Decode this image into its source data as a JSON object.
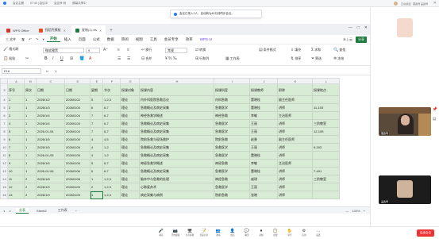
{
  "meeting": {
    "top_items": [
      "会议主题",
      "07:43 | 会议中",
      "会议号 码",
      "屏幕共享中"
    ],
    "right_label": "正在讲话：董鑫琦 盖鑫琦",
    "toast": "会议已录入2人，自动转为40分钟同步会议。"
  },
  "tabs": [
    {
      "label": "WPS Office",
      "color": "#d9342b",
      "active": false
    },
    {
      "label": "找稻壳模板",
      "color": "#e8491d",
      "active": false
    },
    {
      "label": "复制(1).xls",
      "color": "#1f7a3f",
      "active": true
    }
  ],
  "menu": {
    "file": "三 文件",
    "items": [
      "开始",
      "插入",
      "页面",
      "公式",
      "数据",
      "审阅",
      "视图",
      "工具",
      "会员专享",
      "效率"
    ],
    "active_index": 0,
    "wps_ai": "WPS AI",
    "right": [
      "未上云",
      "分享"
    ]
  },
  "ribbon": {
    "format_painter": "格式刷",
    "paste": "粘贴",
    "font_name": "微软雅黑",
    "font_size": "9",
    "wrap": "换行",
    "merge": "合并",
    "number_format": "常规",
    "convert": "转换",
    "rows_cols": "行和列",
    "worksheet": "工作表",
    "cond_format": "条件格式",
    "fill": "填充",
    "sort": "排序",
    "filter": "筛选",
    "find": "查找",
    "sum": "求和",
    "freeze": "冻结"
  },
  "formula_bar": {
    "cell_ref": "E16",
    "fx": "fx",
    "value": "1"
  },
  "grid": {
    "columns": [
      "A",
      "B",
      "C",
      "D",
      "E",
      "F",
      "G",
      "H",
      "I",
      "J",
      "K",
      "L"
    ],
    "header_row": [
      "序号",
      "周次",
      "日期",
      "日期",
      "星期",
      "节次",
      "授课对象",
      "授课内容",
      "授课科室",
      "授课教师",
      "职称",
      "授课地点"
    ],
    "rows": [
      {
        "rn": "4",
        "cells": [
          "1",
          "1",
          "2026/1/2",
          "20260102",
          "5",
          "1,2,3",
          "理论",
          "内外科医院急救总论",
          "内科急救",
          "董晓桂",
          "副主任医师",
          ""
        ]
      },
      {
        "rn": "5",
        "cells": [
          "2",
          "1",
          "2026/1/3",
          "20260103",
          "6",
          "6-7",
          "理论",
          "急救概论及病史采集",
          "急救医学",
          "董晓桂",
          "讲师",
          "11-103"
        ]
      },
      {
        "rn": "6",
        "cells": [
          "3",
          "1",
          "2026/1/4",
          "20260104",
          "7",
          "6-7",
          "理论",
          "神经急救学概述",
          "神经急救",
          "李敏",
          "主治医师",
          ""
        ]
      },
      {
        "rn": "7",
        "cells": [
          "4",
          "1",
          "2026/1/4",
          "20260104",
          "7",
          "6-7",
          "理论",
          "急救概论及病史采集",
          "急救医学",
          "王丽",
          "讲师",
          "三阶教室"
        ]
      },
      {
        "rn": "8",
        "cells": [
          "5",
          "1",
          "2026-01-04",
          "20260104",
          "7",
          "6-7",
          "理论",
          "急救概论及病史采集",
          "急救医学",
          "王丽",
          "讲师",
          "12-105"
        ]
      },
      {
        "rn": "9",
        "cells": [
          "6",
          "1",
          "2026/1/5",
          "20260105",
          "4",
          "4,5",
          "理论",
          "院前急救与现场救护",
          "院前急救",
          "赵勇",
          "副主任医师",
          ""
        ]
      },
      {
        "rn": "10",
        "cells": [
          "7",
          "1",
          "2026/1/5",
          "20260105",
          "4",
          "1-2",
          "理论",
          "急救概论及病史采集",
          "急救医学",
          "王丽",
          "讲师",
          "9-203"
        ]
      },
      {
        "rn": "11",
        "cells": [
          "8",
          "1",
          "2026-01-05",
          "20260105",
          "4",
          "1-2",
          "理论",
          "急救概论及病史采集",
          "急救医学",
          "董晓桂",
          "讲师",
          ""
        ]
      },
      {
        "rn": "12",
        "cells": [
          "9",
          "1",
          "2026/1/6",
          "20260106",
          "5",
          "6-7",
          "理论",
          "神经急救学概述",
          "神经急救",
          "李敏",
          "主治医师",
          ""
        ]
      },
      {
        "rn": "13",
        "cells": [
          "10",
          "1",
          "2026-01-06",
          "20260106",
          "5",
          "6-7",
          "理论",
          "急救概论及病史采集",
          "急救医学",
          "董晓桂",
          "讲师",
          "7-401"
        ]
      },
      {
        "rn": "14",
        "cells": [
          "11",
          "2",
          "2026/1/8",
          "20260108",
          "1",
          "1,2,3",
          "理论",
          "脑卒中与急救的处理",
          "神经急救",
          "戚琪",
          "讲师",
          "三阶教室"
        ]
      },
      {
        "rn": "15",
        "cells": [
          "12",
          "2",
          "2026/1/9",
          "20260109",
          "2",
          "1,2,3",
          "理论",
          "心肺复苏术",
          "急救医学",
          "王丽",
          "讲师",
          ""
        ]
      },
      {
        "rn": "16",
        "cells": [
          "13",
          "2",
          "2026/1/9",
          "20260109",
          "1",
          "1,2,3",
          "理论",
          "病史采集与病例",
          "院前急救",
          "张晓",
          "讲师",
          ""
        ]
      }
    ]
  },
  "sheets": {
    "tabs": [
      "总表",
      "Sheet2",
      "工作表"
    ],
    "active_index": 0,
    "zoom": "100%"
  },
  "bottom_toolbar": [
    {
      "icon": "🎤",
      "label": "静音"
    },
    {
      "icon": "📷",
      "label": "开启视频"
    },
    {
      "icon": "🖥",
      "label": "共享屏幕"
    },
    {
      "icon": "📝",
      "label": "结束共享"
    },
    {
      "icon": "👥",
      "label": "邀请"
    },
    {
      "icon": "👤",
      "label": "成员"
    },
    {
      "icon": "💬",
      "label": "聊天"
    },
    {
      "icon": "⏺",
      "label": "录制"
    },
    {
      "icon": "📋",
      "label": "纪要"
    },
    {
      "icon": "✋",
      "label": "举手"
    },
    {
      "icon": "⚙",
      "label": "应用"
    },
    {
      "icon": "…",
      "label": "设置"
    }
  ],
  "end_button": "结束会议",
  "participants": [
    {
      "name": "",
      "kind": "avatar"
    },
    {
      "name": "董鑫琦",
      "kind": "cam"
    },
    {
      "name": "盖鑫琦",
      "kind": "dark"
    }
  ]
}
